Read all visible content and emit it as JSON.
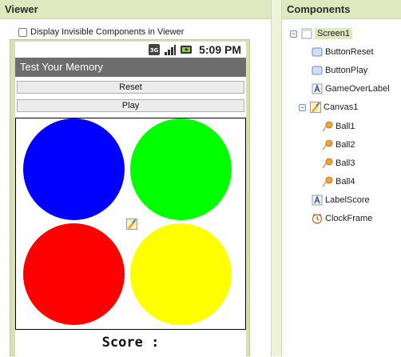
{
  "viewer": {
    "header_label": "Viewer",
    "display_invisible_label": "Display Invisible Components in Viewer",
    "display_invisible_checked": false,
    "status_time": "5:09 PM",
    "screen_title": "Test Your Memory",
    "reset_label": "Reset",
    "play_label": "Play",
    "score_label": "Score :",
    "balls": [
      {
        "name": "Ball1",
        "color": "#0000ff"
      },
      {
        "name": "Ball2",
        "color": "#00ff00"
      },
      {
        "name": "Ball3",
        "color": "#ff0000"
      },
      {
        "name": "Ball4",
        "color": "#ffff00"
      }
    ]
  },
  "components": {
    "header_label": "Components",
    "tree": [
      {
        "label": "Screen1",
        "icon": "screen-icon",
        "expanded": true,
        "selected": true
      },
      {
        "label": "ButtonReset",
        "icon": "button-icon"
      },
      {
        "label": "ButtonPlay",
        "icon": "button-icon"
      },
      {
        "label": "GameOverLabel",
        "icon": "label-icon"
      },
      {
        "label": "Canvas1",
        "icon": "canvas-icon",
        "expanded": true
      },
      {
        "label": "Ball1",
        "icon": "ball-icon"
      },
      {
        "label": "Ball2",
        "icon": "ball-icon"
      },
      {
        "label": "Ball3",
        "icon": "ball-icon"
      },
      {
        "label": "Ball4",
        "icon": "ball-icon"
      },
      {
        "label": "LabelScore",
        "icon": "label-icon"
      },
      {
        "label": "ClockFrame",
        "icon": "clock-icon"
      }
    ]
  }
}
